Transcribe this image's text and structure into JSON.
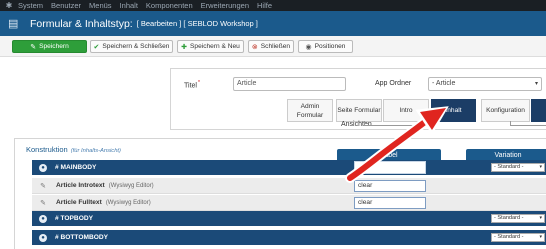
{
  "menubar": {
    "logo_icon": "joomla-logo-icon",
    "items": [
      "System",
      "Benutzer",
      "Menüs",
      "Inhalt",
      "Komponenten",
      "Erweiterungen",
      "Hilfe"
    ]
  },
  "header": {
    "title": "Formular & Inhaltstyp:",
    "breadcrumb": "[ Bearbeiten ] [ SEBLOD Workshop ]"
  },
  "toolbar": {
    "save": "Speichern",
    "save_close": "Speichern & Schließen",
    "save_new": "Speichern & Neu",
    "close": "Schließen",
    "positions": "Positionen"
  },
  "form": {
    "title_label": "Titel",
    "required_mark": "*",
    "title_value": "Article",
    "app_folder_label": "App Ordner",
    "app_folder_value": "- Article"
  },
  "tabs": {
    "admin": "Admin Formular",
    "site": "Seite Formular",
    "intro": "Intro",
    "content": "Inhalt",
    "config": "Konfiguration",
    "views_label": "Ansichten"
  },
  "construction": {
    "title": "Konstruktion",
    "subtitle": "(für Inhalts-Ansicht)",
    "col_label": "Label",
    "col_variation": "Variation",
    "rows": [
      {
        "name": "# MAINBODY",
        "variation": "- Standard -"
      },
      {
        "name": "Article Introtext",
        "sub": "(Wysiwyg Editor)",
        "value": "clear"
      },
      {
        "name": "Article Fulltext",
        "sub": "(Wysiwyg Editor)",
        "value": "clear"
      },
      {
        "name": "# TOPBODY",
        "variation": "- Standard -"
      },
      {
        "name": "# BOTTOMBODY",
        "variation": "- Standard -"
      }
    ]
  },
  "colors": {
    "menubar": "#1a1f24",
    "header": "#1b5a8c",
    "save_button": "#2e9e3a",
    "active_tab": "#1b3d66",
    "row_header": "#1b4a78",
    "annotation_arrow": "#e0251f"
  }
}
